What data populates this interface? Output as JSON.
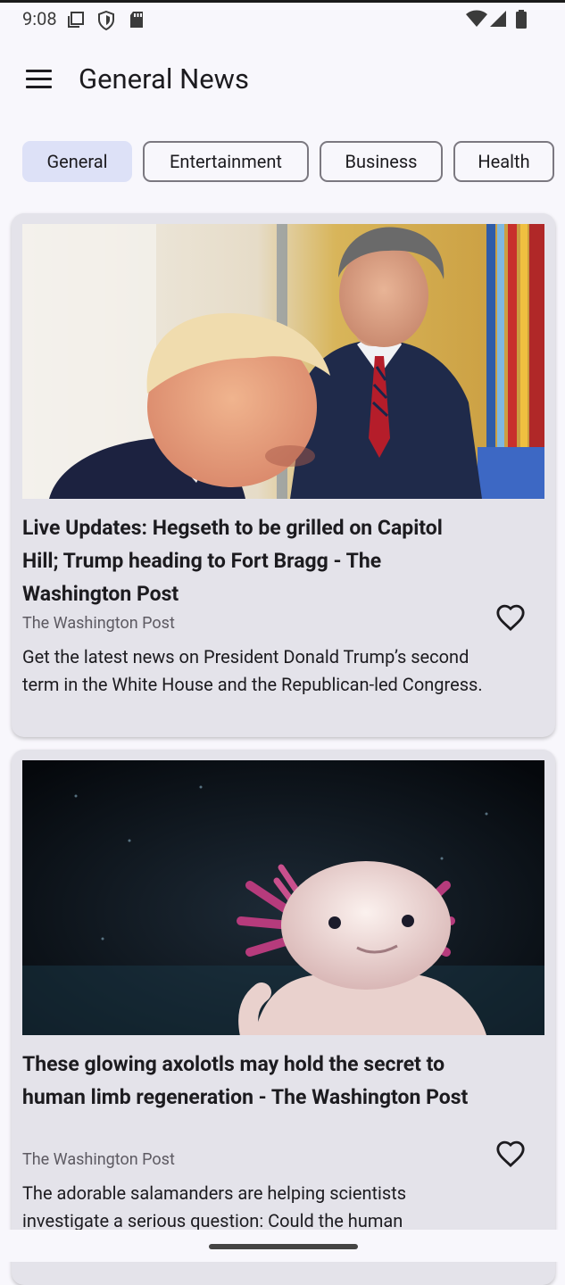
{
  "status_bar": {
    "time": "9:08",
    "icons": [
      "screenshot-icon",
      "shield-icon",
      "sd-card-icon",
      "wifi-icon",
      "signal-icon",
      "battery-icon"
    ]
  },
  "app_bar": {
    "menu_icon": "hamburger-menu-icon",
    "title": "General News"
  },
  "categories": [
    {
      "label": "General",
      "selected": true
    },
    {
      "label": "Entertainment",
      "selected": false
    },
    {
      "label": "Business",
      "selected": false
    },
    {
      "label": "Health",
      "selected": false
    }
  ],
  "articles": [
    {
      "headline": "Live Updates: Hegseth to be grilled on Capitol Hill; Trump heading to Fort Bragg - The Washington Post",
      "source": "The Washington Post",
      "description": "Get the latest news on President Donald Trump’s second term in the White House and the Republican-led Congress.",
      "favorite_icon": "heart-outline-icon"
    },
    {
      "headline": "These glowing axolotls may hold the secret to human limb regeneration - The Washington Post",
      "source": "The Washington Post",
      "description": "The adorable salamanders are helping scientists investigate a serious question: Could the human",
      "favorite_icon": "heart-outline-icon"
    }
  ],
  "colors": {
    "background": "#f8f7fc",
    "card": "#e4e3ea",
    "selected_chip": "#dde1f7",
    "chip_border": "#7b7880"
  }
}
